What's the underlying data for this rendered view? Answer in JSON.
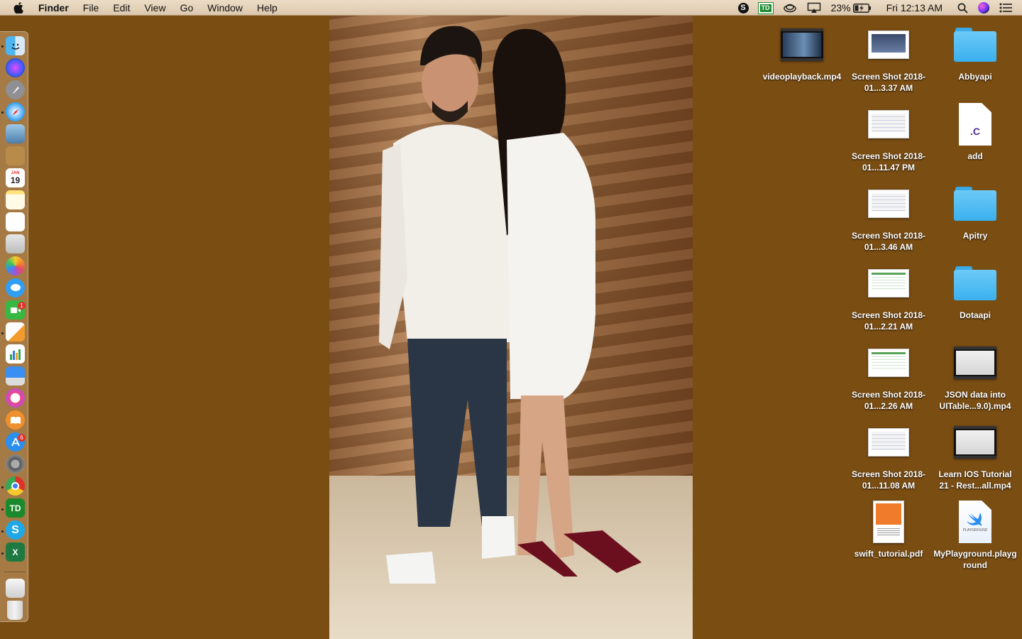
{
  "menubar": {
    "app_name": "Finder",
    "menus": [
      "File",
      "Edit",
      "View",
      "Go",
      "Window",
      "Help"
    ],
    "battery_percent": "23%",
    "clock": "Fri 12:13 AM",
    "status_icons": [
      "skype-icon",
      "td-icon",
      "creative-cloud-icon",
      "airplay-icon",
      "battery-icon",
      "spotlight-icon",
      "siri-icon",
      "notification-center-icon"
    ]
  },
  "dock": {
    "apps": [
      "Finder",
      "Siri",
      "Launchpad",
      "Safari",
      "Preview",
      "Contacts",
      "Calendar",
      "Notes",
      "Reminders",
      "Photo Booth",
      "Photos",
      "Messages",
      "FaceTime",
      "Pages",
      "Numbers",
      "Keynote",
      "iTunes",
      "iBooks",
      "App Store",
      "System Preferences",
      "Chrome",
      "TD Ameritrade",
      "Skype",
      "Excel",
      "Downloads",
      "Trash"
    ],
    "calendar_day": "19",
    "calendar_month": "JAN",
    "facetime_badge": "1",
    "appstore_badge": "6"
  },
  "desktop": {
    "col1": [
      {
        "label": "videoplayback.mp4",
        "kind": "video"
      }
    ],
    "col2": [
      {
        "label": "Screen Shot 2018-01...3.37 AM",
        "kind": "shot"
      },
      {
        "label": "Screen Shot 2018-01...11.47 PM",
        "kind": "shot"
      },
      {
        "label": "Screen Shot 2018-01...3.46 AM",
        "kind": "shot"
      },
      {
        "label": "Screen Shot 2018-01...2.21 AM",
        "kind": "sheet"
      },
      {
        "label": "Screen Shot 2018-01...2.26 AM",
        "kind": "sheet"
      },
      {
        "label": "Screen Shot 2018-01...11.08 AM",
        "kind": "shot"
      },
      {
        "label": "swift_tutorial.pdf",
        "kind": "pdf"
      }
    ],
    "col3": [
      {
        "label": "Abbyapi",
        "kind": "folder"
      },
      {
        "label": "add",
        "kind": "c-file",
        "ext": ".C"
      },
      {
        "label": "Apitry",
        "kind": "folder"
      },
      {
        "label": "Dotaapi",
        "kind": "folder"
      },
      {
        "label": "JSON data into UITable...9.0).mp4",
        "kind": "video"
      },
      {
        "label": "Learn IOS Tutorial 21 - Rest...all.mp4",
        "kind": "video"
      },
      {
        "label": "MyPlayground.playground",
        "kind": "playground",
        "badge": "PLAYGROUND"
      }
    ]
  },
  "colors": {
    "desktop_bg": "#7a4d12",
    "menubar_bg": "#e5d3bb",
    "folder_blue": "#3ab0ef"
  }
}
